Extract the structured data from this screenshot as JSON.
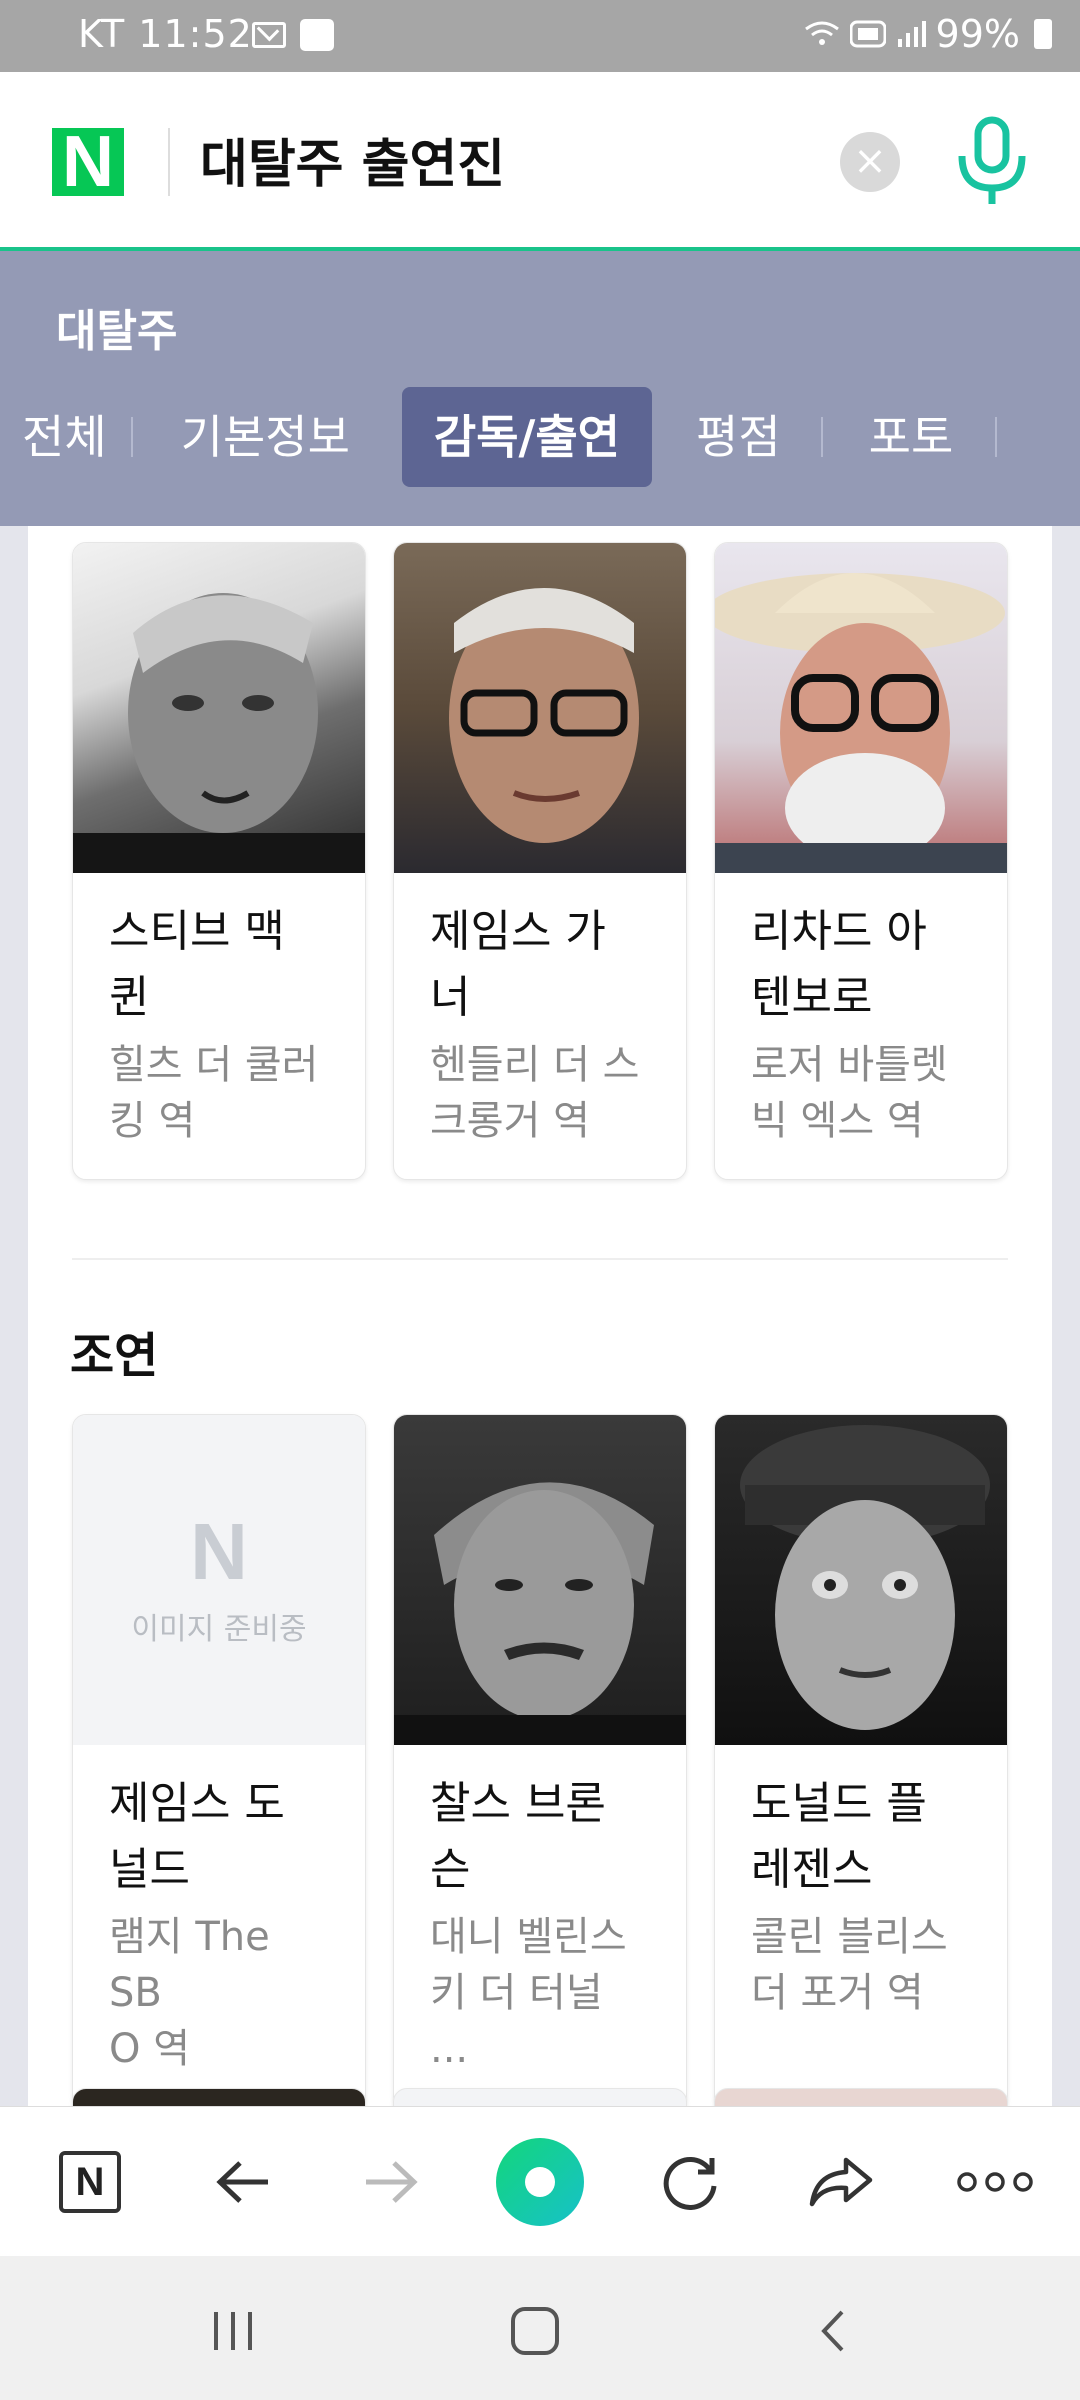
{
  "status_bar": {
    "carrier": "KT",
    "time": "11:52",
    "battery": "99%",
    "icons": [
      "mail-icon",
      "mglobal-icon",
      "wifi-icon",
      "hd-icon",
      "signal-icon",
      "battery-icon"
    ]
  },
  "search": {
    "logo": "N",
    "query": "대탈주 출연진",
    "icons": [
      "clear-icon",
      "microphone-icon"
    ]
  },
  "category": {
    "title": "대탈주",
    "tabs": [
      {
        "label": "전체",
        "active": false
      },
      {
        "label": "기본정보",
        "active": false
      },
      {
        "label": "감독/출연",
        "active": true
      },
      {
        "label": "평점",
        "active": false
      },
      {
        "label": "포토",
        "active": false
      }
    ]
  },
  "main_cast": [
    {
      "name_line1": "스티브 맥",
      "name_line2": "퀸",
      "role_line1": "힐츠 더 쿨러",
      "role_line2": "킹 역"
    },
    {
      "name_line1": "제임스 가",
      "name_line2": "너",
      "role_line1": "헨들리 더 스",
      "role_line2": "크롱거 역"
    },
    {
      "name_line1": "리차드 아",
      "name_line2": "텐보로",
      "role_line1": "로저 바틀렛",
      "role_line2": "빅 엑스 역"
    }
  ],
  "supporting": {
    "title": "조연",
    "placeholder_logo": "N",
    "placeholder_text": "이미지 준비중",
    "cast": [
      {
        "name_line1": "제임스 도",
        "name_line2": "널드",
        "role_line1": "램지 The SB",
        "role_line2": "O 역"
      },
      {
        "name_line1": "찰스 브론",
        "name_line2": "슨",
        "role_line1": "대니 벨린스",
        "role_line2": "키 더 터널 ..."
      },
      {
        "name_line1": "도널드 플",
        "name_line2": "레젠스",
        "role_line1": "콜린 블리스",
        "role_line2": "더 포거 역"
      }
    ]
  },
  "toolbar": {
    "home_logo": "N",
    "icons": [
      "naver-home-icon",
      "back-arrow-icon",
      "forward-arrow-icon",
      "green-dot-icon",
      "refresh-icon",
      "share-icon",
      "more-icon"
    ]
  },
  "system_nav": {
    "icons": [
      "recent-apps-icon",
      "home-icon",
      "back-icon"
    ]
  },
  "colors": {
    "naver_green": "#06c755",
    "header_bg": "#949ab5",
    "active_tab": "#5d6593"
  }
}
